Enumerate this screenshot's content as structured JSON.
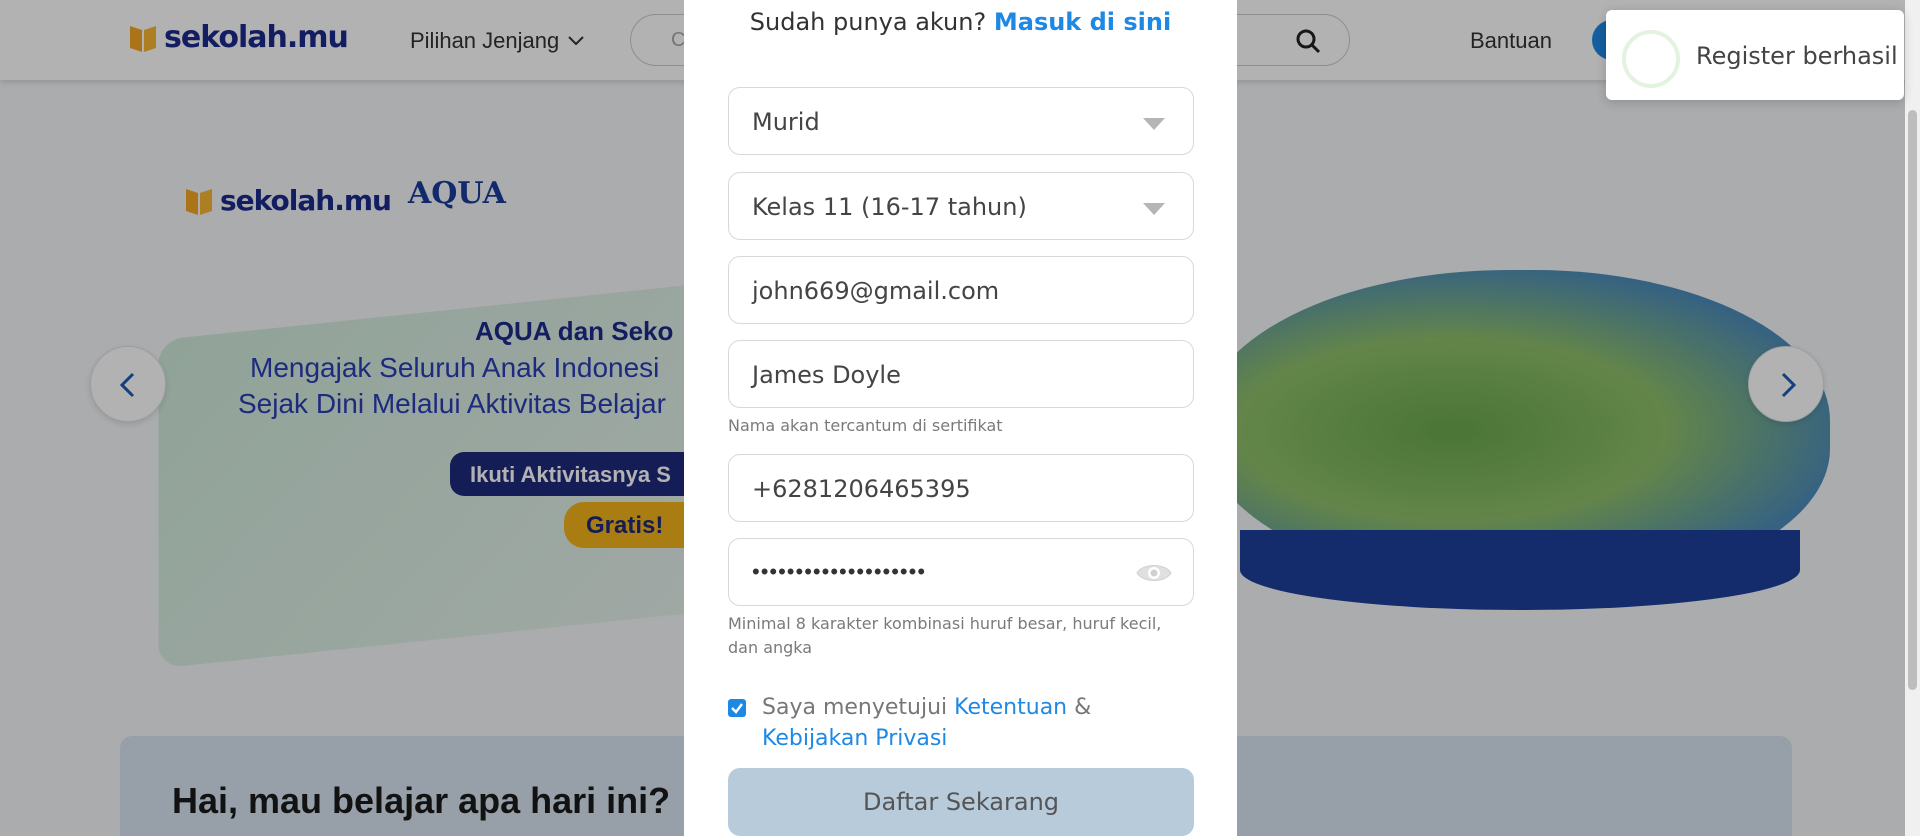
{
  "header": {
    "logo_text": "sekolah.mu",
    "nav_jenjang": "Pilihan Jenjang",
    "search_placeholder": "C",
    "bantuan": "Bantuan"
  },
  "banner": {
    "logo_text": "sekolah.mu",
    "partner_logo": "AQUA",
    "title": "AQUA dan Seko",
    "line1": "Mengajak Seluruh Anak Indonesi",
    "line2": "Sejak Dini Melalui Aktivitas Belajar",
    "pill": "Ikuti Aktivitasnya S",
    "gratis": "Gratis!"
  },
  "greeting": "Hai, mau belajar apa hari ini?",
  "modal": {
    "login_prompt": "Sudah punya akun?",
    "login_link": "Masuk di sini",
    "role_select": "Murid",
    "class_select": "Kelas 11 (16-17 tahun)",
    "email": "john669@gmail.com",
    "name": "James Doyle",
    "name_hint": "Nama akan tercantum di sertifikat",
    "phone": "+6281206465395",
    "password_mask": "••••••••••••••••••••",
    "password_hint": "Minimal 8 karakter kombinasi huruf besar, huruf kecil, dan angka",
    "agree_prefix": "Saya menyetujui",
    "terms_link": "Ketentuan",
    "amp": "&",
    "privacy_link": "Kebijakan Privasi",
    "submit": "Daftar Sekarang"
  },
  "toast": {
    "message": "Register berhasil"
  },
  "colors": {
    "accent": "#1e88e5",
    "brand": "#1c2a8c",
    "submit_disabled": "#b8cbdb"
  }
}
